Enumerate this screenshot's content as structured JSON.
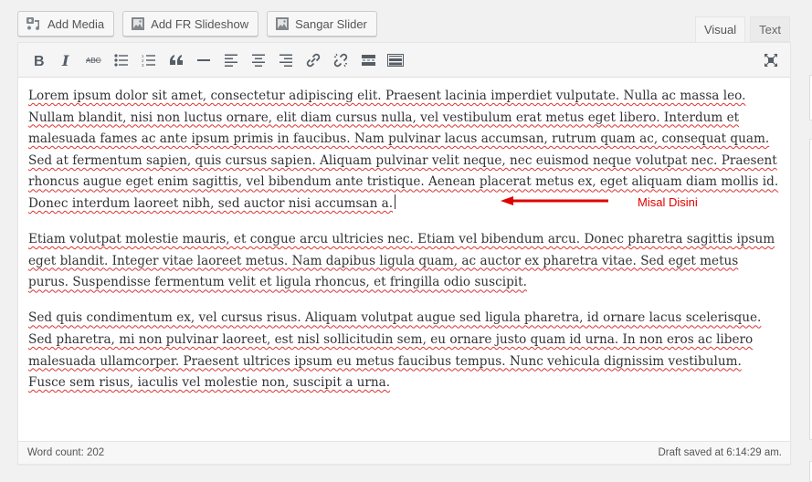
{
  "media_buttons": [
    {
      "label": "Add Media",
      "icon": "add-media-icon"
    },
    {
      "label": "Add FR Slideshow",
      "icon": "image-icon"
    },
    {
      "label": "Sangar Slider",
      "icon": "image-icon"
    }
  ],
  "tabs": [
    {
      "label": "Visual",
      "active": true
    },
    {
      "label": "Text",
      "active": false
    }
  ],
  "toolbar": {
    "buttons": [
      "bold",
      "italic",
      "strikethrough",
      "bulleted-list",
      "numbered-list",
      "blockquote",
      "horizontal-line",
      "align-left",
      "align-center",
      "align-right",
      "insert-link",
      "remove-link",
      "read-more",
      "toolbar-toggle"
    ],
    "right_button": "fullscreen"
  },
  "content": {
    "paragraphs": [
      "Lorem ipsum dolor sit amet, consectetur adipiscing elit. Praesent lacinia imperdiet vulputate. Nulla ac massa leo. Nullam blandit, nisi non luctus ornare, elit diam cursus nulla, vel vestibulum erat metus eget libero. Interdum et malesuada fames ac ante ipsum primis in faucibus. Nam pulvinar lacus accumsan, rutrum quam ac, consequat quam. Sed at fermentum sapien, quis cursus sapien. Aliquam pulvinar velit neque, nec euismod neque volutpat nec. Praesent rhoncus augue eget enim sagittis, vel bibendum ante tristique. Aenean placerat metus ex, eget aliquam diam mollis id. Donec interdum laoreet nibh, sed auctor nisi accumsan a.",
      "Etiam volutpat molestie mauris, et congue arcu ultricies nec. Etiam vel bibendum arcu. Donec pharetra sagittis ipsum eget blandit. Integer vitae laoreet metus. Nam dapibus ligula quam, ac auctor ex pharetra vitae. Sed eget metus purus. Suspendisse fermentum velit et ligula rhoncus, et fringilla odio suscipit.",
      "Sed quis condimentum ex, vel cursus risus. Aliquam volutpat augue sed ligula pharetra, id ornare lacus scelerisque. Sed pharetra, mi non pulvinar laoreet, est nisl sollicitudin sem, eu ornare justo quam id urna. In non eros ac libero malesuada ullamcorper. Praesent ultrices ipsum eu metus faucibus tempus. Nunc vehicula dignissim vestibulum. Fusce sem risus, iaculis vel molestie non, suscipit a urna."
    ],
    "spellcheck_flagged": true
  },
  "annotation": {
    "label": "Misal Disini",
    "color": "#e00000"
  },
  "status": {
    "word_count": "Word count: 202",
    "draft_saved": "Draft saved at 6:14:29 am."
  }
}
